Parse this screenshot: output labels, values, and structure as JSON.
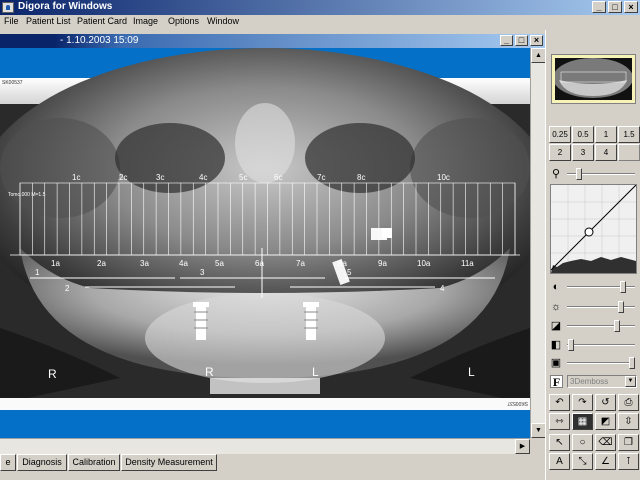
{
  "window": {
    "title": "Digora for Windows",
    "min": "_",
    "max": "□",
    "close": "×"
  },
  "menu": [
    "File",
    "Patient List",
    "Patient Card",
    "Image",
    "Options",
    "Window"
  ],
  "child_window": {
    "title": "- 1.10.2003 15:09",
    "min": "_",
    "max": "□",
    "close": "×"
  },
  "xray": {
    "id_top": "SK00537",
    "id_bottom": "SK00537",
    "measure_label": "Tomo.000 M=1.5",
    "top_markers": [
      "1c",
      "2c",
      "3c",
      "4c",
      "5c",
      "6c",
      "7c",
      "8c",
      "10c"
    ],
    "bottom_markers": [
      "1a",
      "2a",
      "3a",
      "4a",
      "5a",
      "6a",
      "7a",
      "8a",
      "9a",
      "10a",
      "11a"
    ],
    "line_labels": [
      "1",
      "2",
      "3",
      "4",
      "5"
    ],
    "side_labels": [
      "R",
      "R",
      "L",
      "L"
    ]
  },
  "tabs": [
    "Diagnosis",
    "Calibration",
    "Density Measurement"
  ],
  "tab_partial": "e",
  "panel": {
    "zoom_buttons": [
      "0.25",
      "0.5",
      "1",
      "1.5",
      "2",
      "3",
      "4",
      ""
    ],
    "filter_label": "F",
    "filter_value": "3Demboss",
    "sliders": [
      {
        "icon": "magnifier-icon",
        "level": 0.15
      },
      {
        "icon": "contrast-icon",
        "level": 0.85
      },
      {
        "icon": "brightness-icon",
        "level": 0.82
      },
      {
        "icon": "gamma-icon",
        "level": 0.75
      },
      {
        "icon": "sharpen-icon",
        "level": 0.02
      },
      {
        "icon": "density-icon",
        "level": 1.0
      }
    ]
  },
  "colors": {
    "titlebar": "#0a246a",
    "image_band": "#0470c8",
    "thumb_frame": "#f7f3b8"
  }
}
